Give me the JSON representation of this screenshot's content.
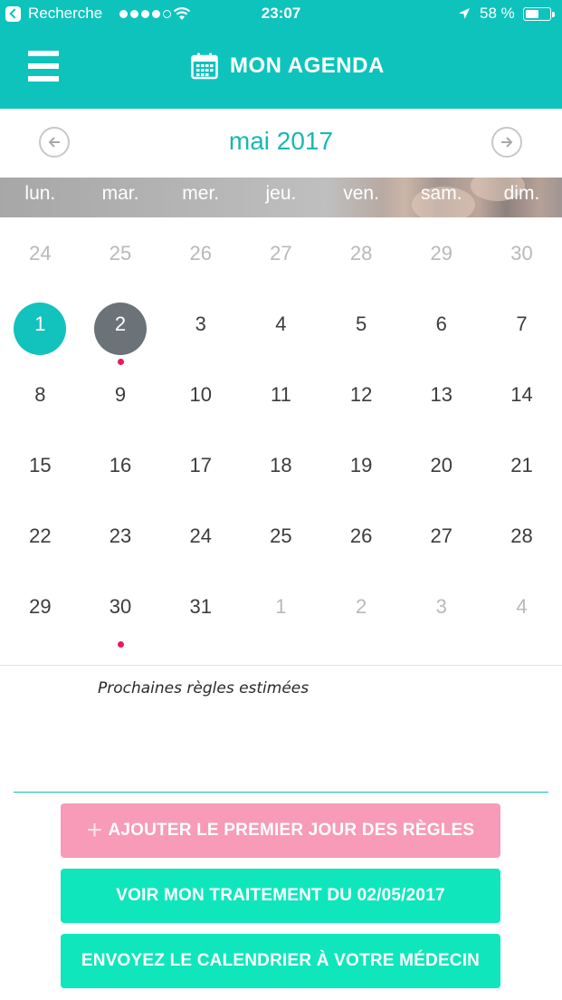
{
  "status_bar": {
    "back_label": "Recherche",
    "time": "23:07",
    "battery": "58 %",
    "battery_level": 0.58,
    "signal_bars": 4,
    "signal_total": 5
  },
  "header": {
    "title": "MON AGENDA",
    "menu_icon": "hamburger-menu-icon",
    "title_icon": "calendar-icon",
    "background": "#0fc3bd"
  },
  "calendar": {
    "month": "mai 2017",
    "prev_icon": "arrow-left-circle-icon",
    "next_icon": "arrow-right-circle-icon",
    "weekdays": [
      "lun.",
      "mar.",
      "mer.",
      "jeu.",
      "ven.",
      "sam.",
      "dim."
    ],
    "weeks": [
      [
        {
          "day": "24",
          "other": true
        },
        {
          "day": "25",
          "other": true
        },
        {
          "day": "26",
          "other": true
        },
        {
          "day": "27",
          "other": true
        },
        {
          "day": "28",
          "other": true
        },
        {
          "day": "29",
          "other": true
        },
        {
          "day": "30",
          "other": true
        }
      ],
      [
        {
          "day": "1",
          "today": true
        },
        {
          "day": "2",
          "selected": true,
          "dot": true
        },
        {
          "day": "3"
        },
        {
          "day": "4"
        },
        {
          "day": "5"
        },
        {
          "day": "6"
        },
        {
          "day": "7"
        }
      ],
      [
        {
          "day": "8"
        },
        {
          "day": "9"
        },
        {
          "day": "10"
        },
        {
          "day": "11"
        },
        {
          "day": "12"
        },
        {
          "day": "13"
        },
        {
          "day": "14"
        }
      ],
      [
        {
          "day": "15"
        },
        {
          "day": "16"
        },
        {
          "day": "17"
        },
        {
          "day": "18"
        },
        {
          "day": "19"
        },
        {
          "day": "20"
        },
        {
          "day": "21"
        }
      ],
      [
        {
          "day": "22"
        },
        {
          "day": "23"
        },
        {
          "day": "24"
        },
        {
          "day": "25"
        },
        {
          "day": "26"
        },
        {
          "day": "27"
        },
        {
          "day": "28"
        }
      ],
      [
        {
          "day": "29"
        },
        {
          "day": "30",
          "dot": true
        },
        {
          "day": "31"
        },
        {
          "day": "1",
          "other": true
        },
        {
          "day": "2",
          "other": true
        },
        {
          "day": "3",
          "other": true
        },
        {
          "day": "4",
          "other": true
        }
      ]
    ],
    "today_color": "#12c2bc",
    "selected_color": "#6b7378",
    "event_dot_color": "#e9195f"
  },
  "legend": {
    "text": "Prochaines règles estimées"
  },
  "actions": {
    "add_first_day": "AJOUTER LE PREMIER JOUR DES RÈGLES",
    "add_icon": "plus-icon",
    "view_treatment": "VOIR MON TRAITEMENT DU 02/05/2017",
    "send_calendar": "ENVOYEZ LE CALENDRIER À VOTRE MÉDECIN",
    "pink_color": "#f79bb8",
    "green_color": "#10e6bc"
  }
}
